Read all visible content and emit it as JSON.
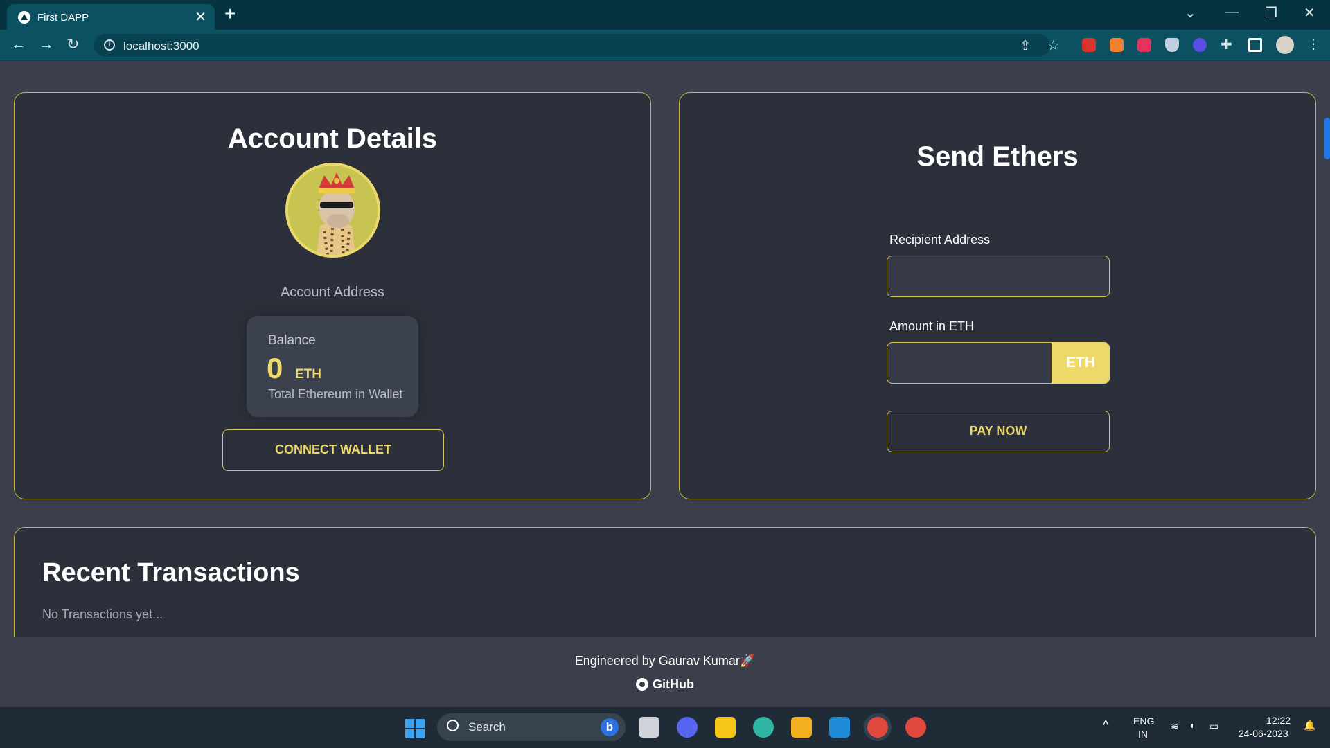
{
  "browser": {
    "tab_title": "First DAPP",
    "tab_close": "✕",
    "new_tab": "+",
    "url": "localhost:3000"
  },
  "account": {
    "title": "Account Details",
    "address_label": "Account Address",
    "balance_label": "Balance",
    "balance_value": "0",
    "balance_unit": "ETH",
    "balance_sub": "Total Ethereum in Wallet",
    "connect_button": "CONNECT WALLET"
  },
  "send": {
    "title": "Send Ethers",
    "recipient_label": "Recipient Address",
    "recipient_value": "",
    "amount_label": "Amount in ETH",
    "amount_value": "",
    "amount_unit": "ETH",
    "pay_button": "PAY NOW"
  },
  "transactions": {
    "title": "Recent Transactions",
    "empty_text": "No Transactions yet..."
  },
  "footer": {
    "credit": "Engineered by Gaurav Kumar🚀",
    "github": "GitHub"
  },
  "taskbar": {
    "search_placeholder": "Search",
    "lang_top": "ENG",
    "lang_bottom": "IN",
    "time": "12:22",
    "date": "24-06-2023"
  },
  "colors": {
    "accent": "#ecd96a",
    "card_bg": "#2c303a",
    "page_bg": "#3a3f4b",
    "chrome_bg": "#053340"
  }
}
